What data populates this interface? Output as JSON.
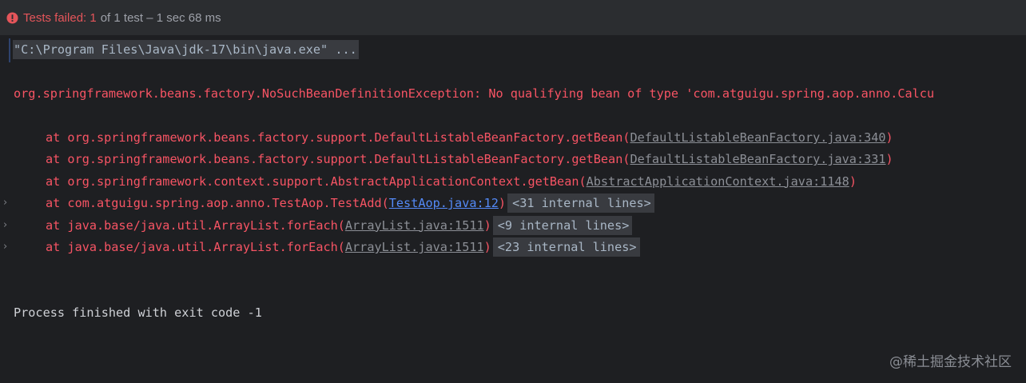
{
  "status": {
    "failed_label": "Tests failed: 1",
    "rest_label": "of 1 test – 1 sec 68 ms",
    "icon": "error-circle-icon",
    "error_color": "#e5555a"
  },
  "console": {
    "command": "\"C:\\Program Files\\Java\\jdk-17\\bin\\java.exe\" ...",
    "exception": "org.springframework.beans.factory.NoSuchBeanDefinitionException: No qualifying bean of type 'com.atguigu.spring.aop.anno.Calcu",
    "trace": [
      {
        "prefix": "at org.springframework.beans.factory.support.DefaultListableBeanFactory.getBean(",
        "link": "DefaultListableBeanFactory.java:340",
        "suffix": ")",
        "internal": null,
        "expandable": false,
        "link_style": "gray"
      },
      {
        "prefix": "at org.springframework.beans.factory.support.DefaultListableBeanFactory.getBean(",
        "link": "DefaultListableBeanFactory.java:331",
        "suffix": ")",
        "internal": null,
        "expandable": false,
        "link_style": "gray"
      },
      {
        "prefix": "at org.springframework.context.support.AbstractApplicationContext.getBean(",
        "link": "AbstractApplicationContext.java:1148",
        "suffix": ")",
        "internal": null,
        "expandable": false,
        "link_style": "gray"
      },
      {
        "prefix": "at com.atguigu.spring.aop.anno.TestAop.TestAdd(",
        "link": "TestAop.java:12",
        "suffix": ")",
        "internal": "<31 internal lines>",
        "expandable": true,
        "link_style": "blue"
      },
      {
        "prefix": "at java.base/java.util.ArrayList.forEach(",
        "link": "ArrayList.java:1511",
        "suffix": ")",
        "internal": "<9 internal lines>",
        "expandable": true,
        "link_style": "gray"
      },
      {
        "prefix": "at java.base/java.util.ArrayList.forEach(",
        "link": "ArrayList.java:1511",
        "suffix": ")",
        "internal": "<23 internal lines>",
        "expandable": true,
        "link_style": "gray"
      }
    ],
    "exit_message": "Process finished with exit code -1"
  },
  "watermark": "@稀土掘金技术社区"
}
